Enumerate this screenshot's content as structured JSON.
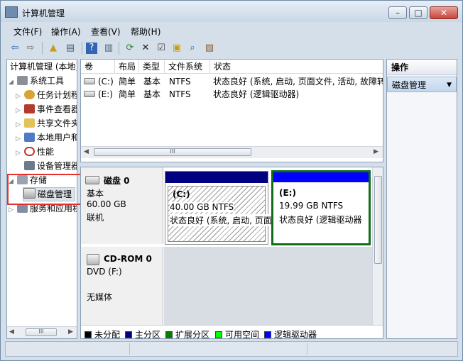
{
  "window": {
    "title": "计算机管理",
    "controls": [
      "–",
      "□",
      "✕"
    ]
  },
  "menu": [
    "文件(F)",
    "操作(A)",
    "查看(V)",
    "帮助(H)"
  ],
  "tree": {
    "root": "计算机管理 (本地)",
    "system_tools": "系统工具",
    "task_scheduler": "任务计划程",
    "event_viewer": "事件查看器",
    "shared_folders": "共享文件夹",
    "local_users": "本地用户和",
    "performance": "性能",
    "device_manager": "设备管理器",
    "storage": "存储",
    "disk_management": "磁盘管理",
    "services": "服务和应用程"
  },
  "volume_table": {
    "headers": [
      "卷",
      "布局",
      "类型",
      "文件系统",
      "状态"
    ],
    "rows": [
      {
        "vol": "(C:)",
        "layout": "简单",
        "type": "基本",
        "fs": "NTFS",
        "status": "状态良好 (系统, 启动, 页面文件, 活动, 故障转"
      },
      {
        "vol": "(E:)",
        "layout": "简单",
        "type": "基本",
        "fs": "NTFS",
        "status": "状态良好 (逻辑驱动器)"
      }
    ]
  },
  "disks": [
    {
      "name": "磁盘 0",
      "type": "基本",
      "size": "60.00 GB",
      "state": "联机",
      "partitions": [
        {
          "label": "(C:)",
          "size": "40.00 GB NTFS",
          "status": "状态良好 (系统, 启动, 页面"
        },
        {
          "label": "(E:)",
          "size": "19.99 GB NTFS",
          "status": "状态良好 (逻辑驱动器"
        }
      ]
    },
    {
      "name": "CD-ROM 0",
      "type": "DVD (F:)",
      "media": "无媒体"
    }
  ],
  "legend": [
    {
      "label": "未分配",
      "color": "#000000"
    },
    {
      "label": "主分区",
      "color": "#000080"
    },
    {
      "label": "扩展分区",
      "color": "#008000"
    },
    {
      "label": "可用空间",
      "color": "#00ff00"
    },
    {
      "label": "逻辑驱动器",
      "color": "#0000ff"
    }
  ],
  "actions": {
    "header": "操作",
    "item": "磁盘管理"
  },
  "scroll_thumb": "III",
  "colors": {
    "highlight": "#e53030",
    "primary_partition": "#000080",
    "logical_drive": "#0000ff",
    "extended_border": "#008000"
  }
}
